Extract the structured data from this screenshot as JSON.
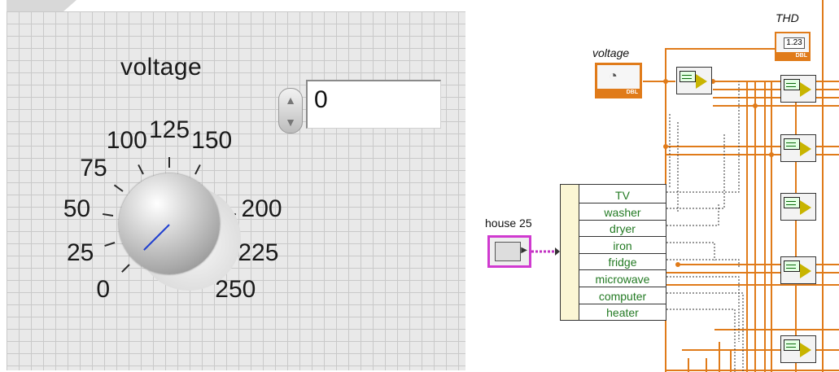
{
  "front_panel": {
    "knob": {
      "label": "voltage",
      "value": 0,
      "min": 0,
      "max": 250,
      "pointer_color": "#1f3fd0",
      "scale_labels": [
        "0",
        "25",
        "50",
        "75",
        "100",
        "125",
        "150",
        "200",
        "225",
        "250"
      ]
    },
    "numeric_control": {
      "value": "0"
    }
  },
  "block_diagram": {
    "voltage_terminal": {
      "label": "voltage",
      "type_tag": "DBL"
    },
    "thd_indicator": {
      "label": "THD",
      "display_value": "1.23",
      "type_tag": "DBL"
    },
    "house_control": {
      "label": "house 25"
    },
    "cluster_items": [
      "TV",
      "washer",
      "dryer",
      "iron",
      "fridge",
      "microwave",
      "computer",
      "heater"
    ],
    "wire_color": "#e07b1a",
    "cluster_wire_color": "#c232c2",
    "label_text_color": "#237a23"
  }
}
